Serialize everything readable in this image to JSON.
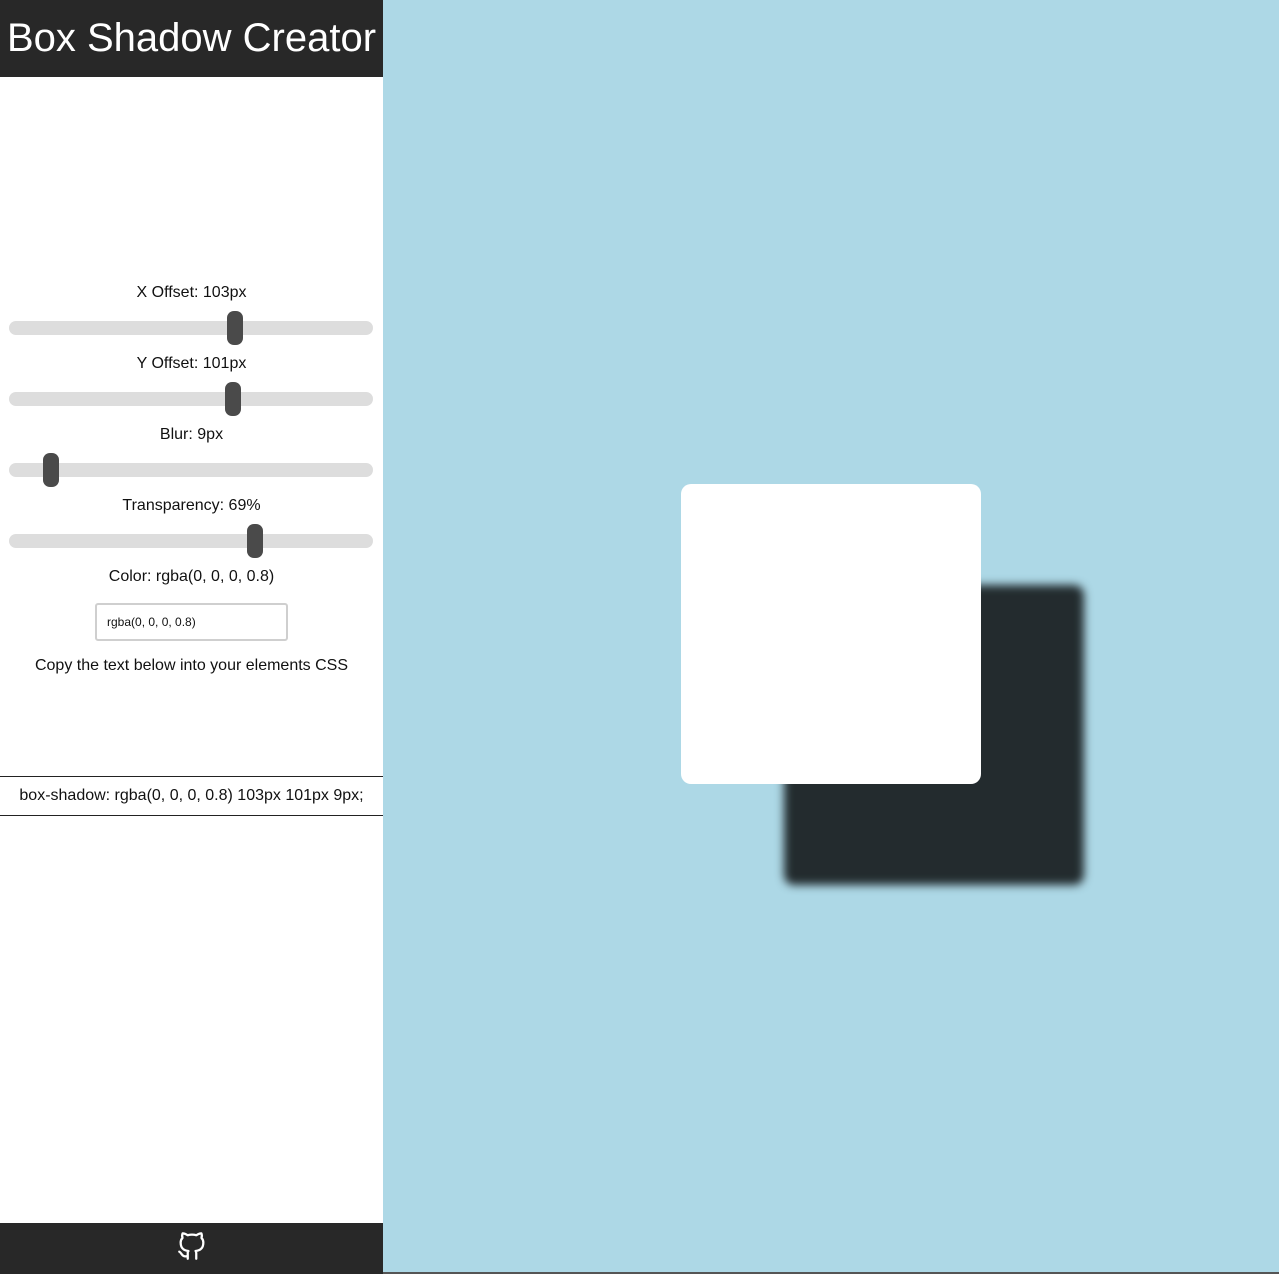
{
  "header": {
    "title": "Box Shadow Creator"
  },
  "controls": {
    "x_offset": {
      "label": "X Offset: 103px",
      "value": 103,
      "fraction": 0.625
    },
    "y_offset": {
      "label": "Y Offset: 101px",
      "value": 101,
      "fraction": 0.622
    },
    "blur": {
      "label": "Blur: 9px",
      "value": 9,
      "fraction": 0.098
    },
    "transparency": {
      "label": "Transparency: 69%",
      "value": 69,
      "fraction": 0.684
    },
    "color": {
      "label": "Color: rgba(0, 0, 0, 0.8)",
      "value": "rgba(0, 0, 0, 0.8)"
    }
  },
  "instruction": "Copy the text below into your elements CSS",
  "output": {
    "css": "box-shadow: rgba(0, 0, 0, 0.8) 103px 101px 9px;"
  },
  "footer": {
    "icon": "github-icon"
  },
  "colors": {
    "header_bg": "#282828",
    "stage_bg": "#add8e6",
    "thumb": "#4a4a4a",
    "track": "#dddddd",
    "preview_box": "#ffffff",
    "shadow": "rgba(0, 0, 0, 0.8)"
  }
}
